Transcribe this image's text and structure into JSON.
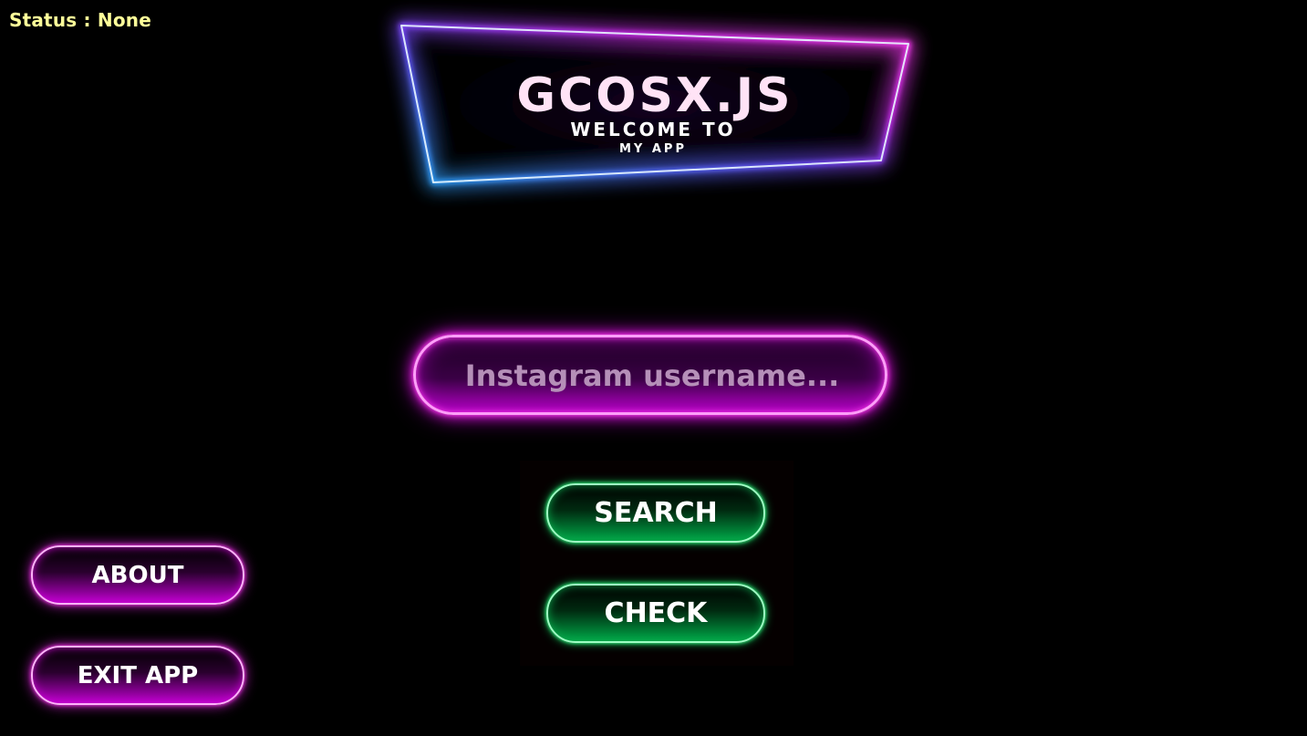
{
  "status": {
    "text": "Status : None"
  },
  "banner": {
    "title": "GCOSX.JS",
    "subtitle": "WELCOME TO",
    "subtitle2": "MY APP"
  },
  "search": {
    "placeholder": "Instagram username...",
    "value": ""
  },
  "actions": {
    "search_label": "SEARCH",
    "check_label": "CHECK"
  },
  "menu": {
    "about_label": "ABOUT",
    "exit_label": "EXIT APP"
  },
  "colors": {
    "background": "#000000",
    "status_text": "#ffff99",
    "neon_pink": "#ff3cf0",
    "neon_blue": "#1e90ff",
    "neon_green": "#3cff8c"
  }
}
